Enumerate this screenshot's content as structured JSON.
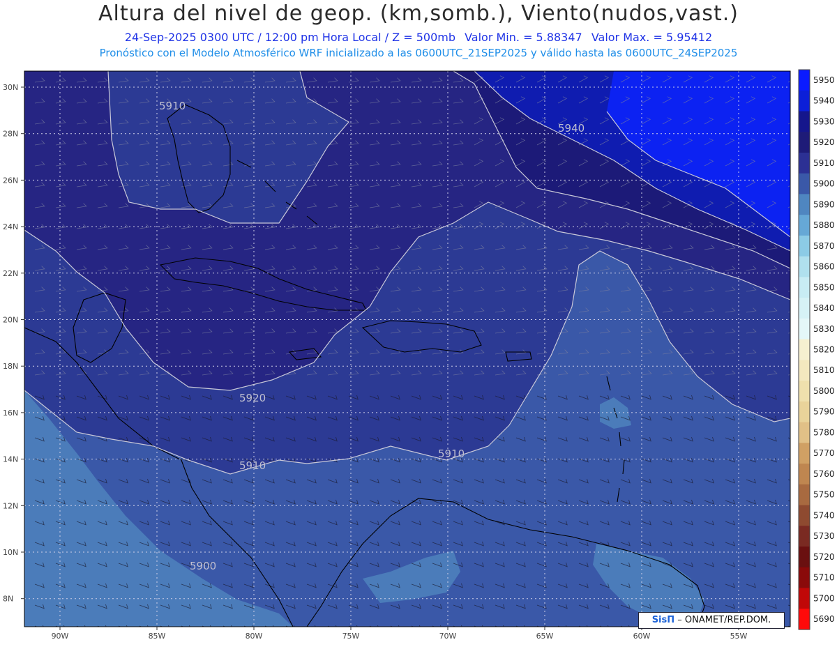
{
  "header": {
    "title": "Altura del nivel de geop. (km,somb.), Viento(nudos,vast.)",
    "line2_valid": "24-Sep-2025  0300 UTC / 12:00 pm Hora Local / Z = 500mb",
    "line2_min": "Valor Min. = 5.88347",
    "line2_max": "Valor Max. = 5.95412",
    "line3": "Pronóstico con el Modelo Atmosférico WRF inicializado a las 0600UTC_21SEP2025 y válido hasta las  0600UTC_24SEP2025"
  },
  "map": {
    "lat_labels": [
      "30N",
      "28N",
      "26N",
      "24N",
      "22N",
      "20N",
      "18N",
      "16N",
      "14N",
      "12N",
      "10N",
      "8N"
    ],
    "lon_labels": [
      "90W",
      "85W",
      "80W",
      "75W",
      "70W",
      "65W",
      "60W",
      "55W"
    ],
    "contour_labels": [
      "5910",
      "5940",
      "5920",
      "5910",
      "5910",
      "5900"
    ],
    "colors": {
      "c5950": "#0c22f2",
      "c5940": "#0f1cb0",
      "c5930": "#1c1a78",
      "c5920": "#262583",
      "c5910": "#2c3a94",
      "c5900": "#3a58a8",
      "c5890": "#4b7cba",
      "coast": "#000000",
      "contour": "#c8c8d8",
      "barb": "#7a7fa0"
    }
  },
  "colorbar": {
    "labels": [
      "5950",
      "5940",
      "5930",
      "5920",
      "5910",
      "5900",
      "5890",
      "5880",
      "5870",
      "5860",
      "5850",
      "5840",
      "5830",
      "5820",
      "5810",
      "5800",
      "5790",
      "5780",
      "5770",
      "5760",
      "5750",
      "5740",
      "5730",
      "5720",
      "5710",
      "5700",
      "5690"
    ],
    "colors": [
      "#0b1bff",
      "#0c1fd8",
      "#15168c",
      "#1e1b78",
      "#2c3094",
      "#3a58a8",
      "#4f86c0",
      "#66a8d6",
      "#8ccbe6",
      "#b0e0ee",
      "#c8ecf4",
      "#d6f2f6",
      "#e4f7f8",
      "#f6f0d0",
      "#f3e8bf",
      "#efe0ad",
      "#e9d39a",
      "#e1c087",
      "#d0a064",
      "#bf8650",
      "#a86a40",
      "#8e4a30",
      "#7a2a22",
      "#6a1010",
      "#8a0a0a",
      "#c00808",
      "#ff0a0a"
    ]
  },
  "credit": {
    "brand": "SisΠ",
    "text": "– ONAMET/REP.DOM."
  }
}
